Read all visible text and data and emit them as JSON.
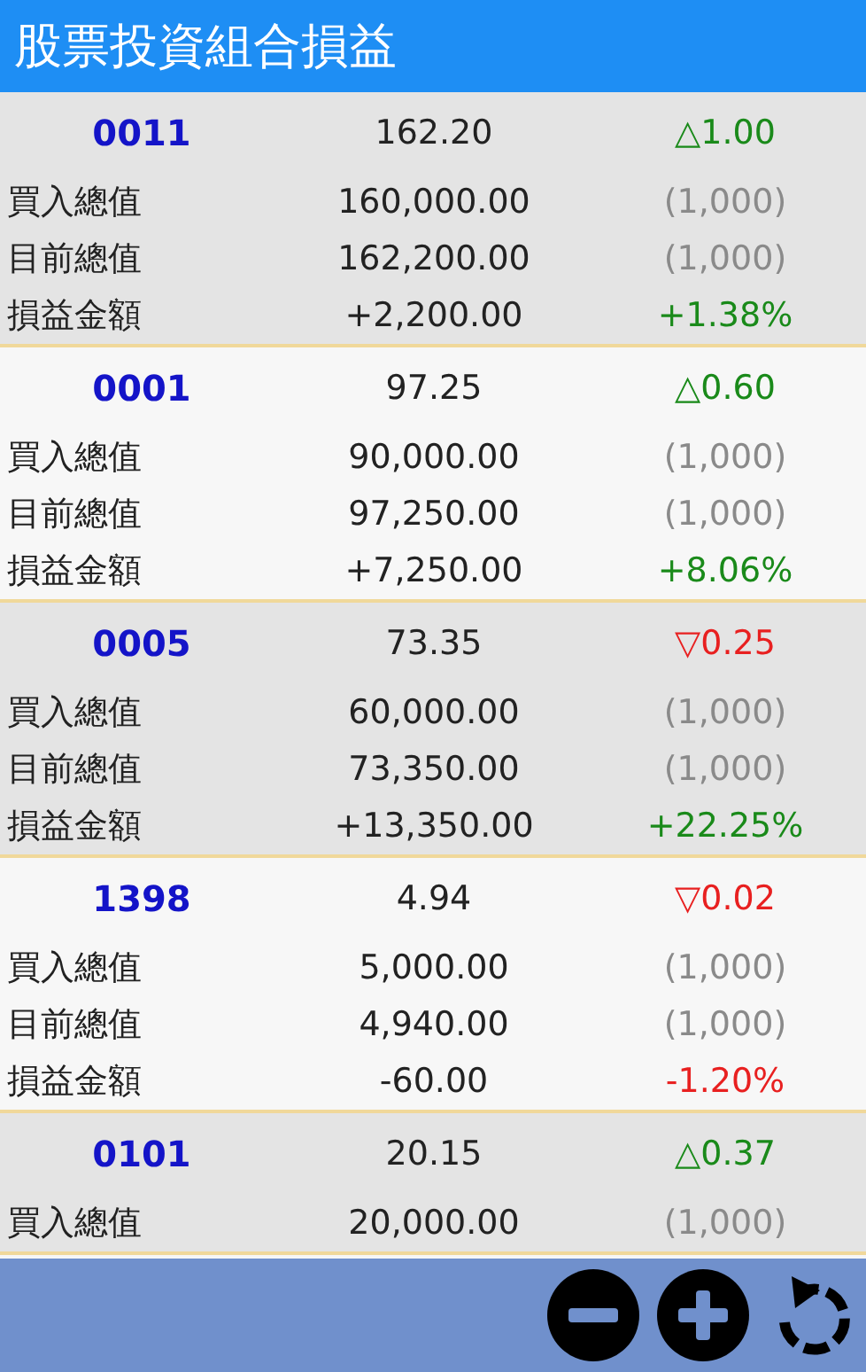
{
  "title": "股票投資組合損益",
  "stocks": [
    {
      "code": "0011",
      "price": "162.20",
      "change": "△1.00",
      "kind": "up",
      "rows": [
        {
          "label": "買入總值",
          "value": "160,000.00",
          "note": "(1,000)",
          "kind": "count"
        },
        {
          "label": "目前總值",
          "value": "162,200.00",
          "note": "(1,000)",
          "kind": "count"
        },
        {
          "label": "損益金額",
          "value": "+2,200.00",
          "note": "+1.38%",
          "kind": "gain"
        }
      ]
    },
    {
      "code": "0001",
      "price": "97.25",
      "change": "△0.60",
      "kind": "up",
      "rows": [
        {
          "label": "買入總值",
          "value": "90,000.00",
          "note": "(1,000)",
          "kind": "count"
        },
        {
          "label": "目前總值",
          "value": "97,250.00",
          "note": "(1,000)",
          "kind": "count"
        },
        {
          "label": "損益金額",
          "value": "+7,250.00",
          "note": "+8.06%",
          "kind": "gain"
        }
      ]
    },
    {
      "code": "0005",
      "price": "73.35",
      "change": "▽0.25",
      "kind": "down",
      "rows": [
        {
          "label": "買入總值",
          "value": "60,000.00",
          "note": "(1,000)",
          "kind": "count"
        },
        {
          "label": "目前總值",
          "value": "73,350.00",
          "note": "(1,000)",
          "kind": "count"
        },
        {
          "label": "損益金額",
          "value": "+13,350.00",
          "note": "+22.25%",
          "kind": "gain"
        }
      ]
    },
    {
      "code": "1398",
      "price": "4.94",
      "change": "▽0.02",
      "kind": "down",
      "rows": [
        {
          "label": "買入總值",
          "value": "5,000.00",
          "note": "(1,000)",
          "kind": "count"
        },
        {
          "label": "目前總值",
          "value": "4,940.00",
          "note": "(1,000)",
          "kind": "count"
        },
        {
          "label": "損益金額",
          "value": "-60.00",
          "note": "-1.20%",
          "kind": "loss"
        }
      ]
    },
    {
      "code": "0101",
      "price": "20.15",
      "change": "△0.37",
      "kind": "up",
      "rows": [
        {
          "label": "買入總值",
          "value": "20,000.00",
          "note": "(1,000)",
          "kind": "count"
        }
      ]
    }
  ]
}
